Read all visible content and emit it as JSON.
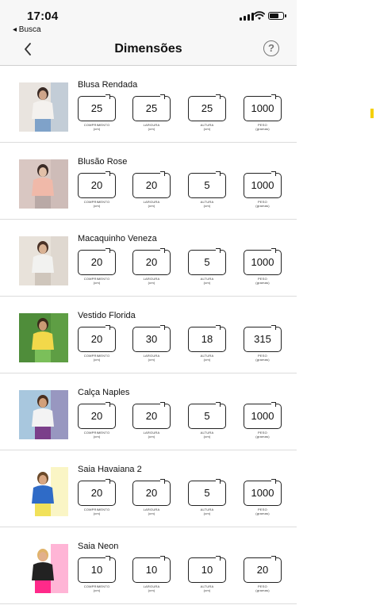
{
  "status_bar": {
    "time": "17:04",
    "back_app": "◂ Busca"
  },
  "nav": {
    "title": "Dimensões",
    "help_icon": "question-circle-icon",
    "back_icon": "chevron-left-icon"
  },
  "field_labels": {
    "length": "COMPRIMENTO",
    "length_unit": "(cm)",
    "width": "LARGURA",
    "width_unit": "(cm)",
    "height": "ALTURA",
    "height_unit": "(cm)",
    "weight": "PESO",
    "weight_unit": "(gramas)"
  },
  "products": [
    {
      "name": "Blusa Rendada",
      "length": "25",
      "width": "25",
      "height": "25",
      "weight": "1000"
    },
    {
      "name": "Blusão Rose",
      "length": "20",
      "width": "20",
      "height": "5",
      "weight": "1000"
    },
    {
      "name": "Macaquinho Veneza",
      "length": "20",
      "width": "20",
      "height": "5",
      "weight": "1000"
    },
    {
      "name": "Vestido Florida",
      "length": "20",
      "width": "30",
      "height": "18",
      "weight": "315"
    },
    {
      "name": "Calça Naples",
      "length": "20",
      "width": "20",
      "height": "5",
      "weight": "1000"
    },
    {
      "name": "Saia Havaiana 2",
      "length": "20",
      "width": "20",
      "height": "5",
      "weight": "1000"
    },
    {
      "name": "Saia Neon",
      "length": "10",
      "width": "10",
      "height": "10",
      "weight": "20"
    }
  ],
  "colors": {
    "accent": "#f5d000",
    "bar_bg": "#f7f7f7",
    "divider": "#dcdcdc"
  }
}
